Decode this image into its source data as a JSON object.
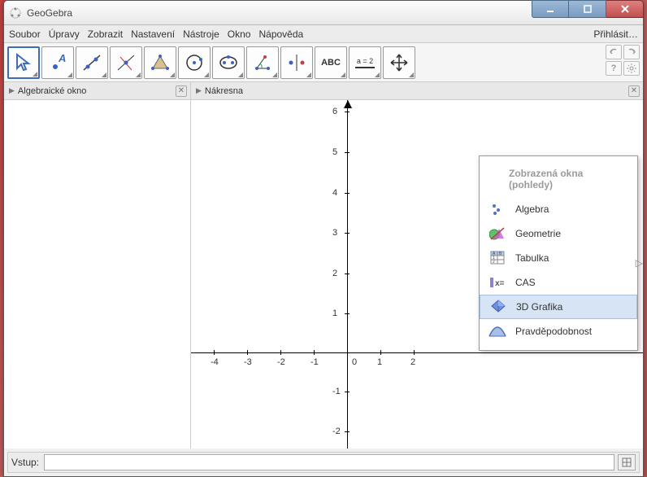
{
  "title": "GeoGebra",
  "menu": {
    "file": "Soubor",
    "edit": "Úpravy",
    "view": "Zobrazit",
    "settings": "Nastavení",
    "tools": "Nástroje",
    "window": "Okno",
    "help": "Nápověda",
    "login": "Přihlásit…"
  },
  "panels": {
    "algebra": "Algebraické okno",
    "graphics": "Nákresna"
  },
  "popup": {
    "title": "Zobrazená okna (pohledy)",
    "items": [
      {
        "label": "Algebra"
      },
      {
        "label": "Geometrie"
      },
      {
        "label": "Tabulka"
      },
      {
        "label": "CAS"
      },
      {
        "label": "3D Grafika"
      },
      {
        "label": "Pravděpodobnost"
      }
    ]
  },
  "input": {
    "label": "Vstup:",
    "value": "",
    "placeholder": ""
  },
  "axes": {
    "x_ticks": [
      {
        "v": "-4",
        "px": -164
      },
      {
        "v": "-3",
        "px": -123
      },
      {
        "v": "-2",
        "px": -82
      },
      {
        "v": "-1",
        "px": -41
      },
      {
        "v": "0",
        "px": 10
      },
      {
        "v": "1",
        "px": 41
      },
      {
        "v": "2",
        "px": 82
      }
    ],
    "y_ticks": [
      {
        "v": "6",
        "px": -296
      },
      {
        "v": "5",
        "px": -246
      },
      {
        "v": "4",
        "px": -196
      },
      {
        "v": "3",
        "px": -147
      },
      {
        "v": "2",
        "px": -97
      },
      {
        "v": "1",
        "px": -48
      },
      {
        "v": "0",
        "px": 4
      },
      {
        "v": "-1",
        "px": 48
      },
      {
        "v": "-2",
        "px": 97
      }
    ]
  },
  "tool_labels": {
    "abc": "ABC",
    "slider": "a = 2"
  },
  "chart_data": {
    "type": "scatter",
    "series": [],
    "xlabel": "",
    "ylabel": "",
    "xlim": [
      -4,
      2
    ],
    "ylim": [
      -2,
      6
    ],
    "title": ""
  }
}
